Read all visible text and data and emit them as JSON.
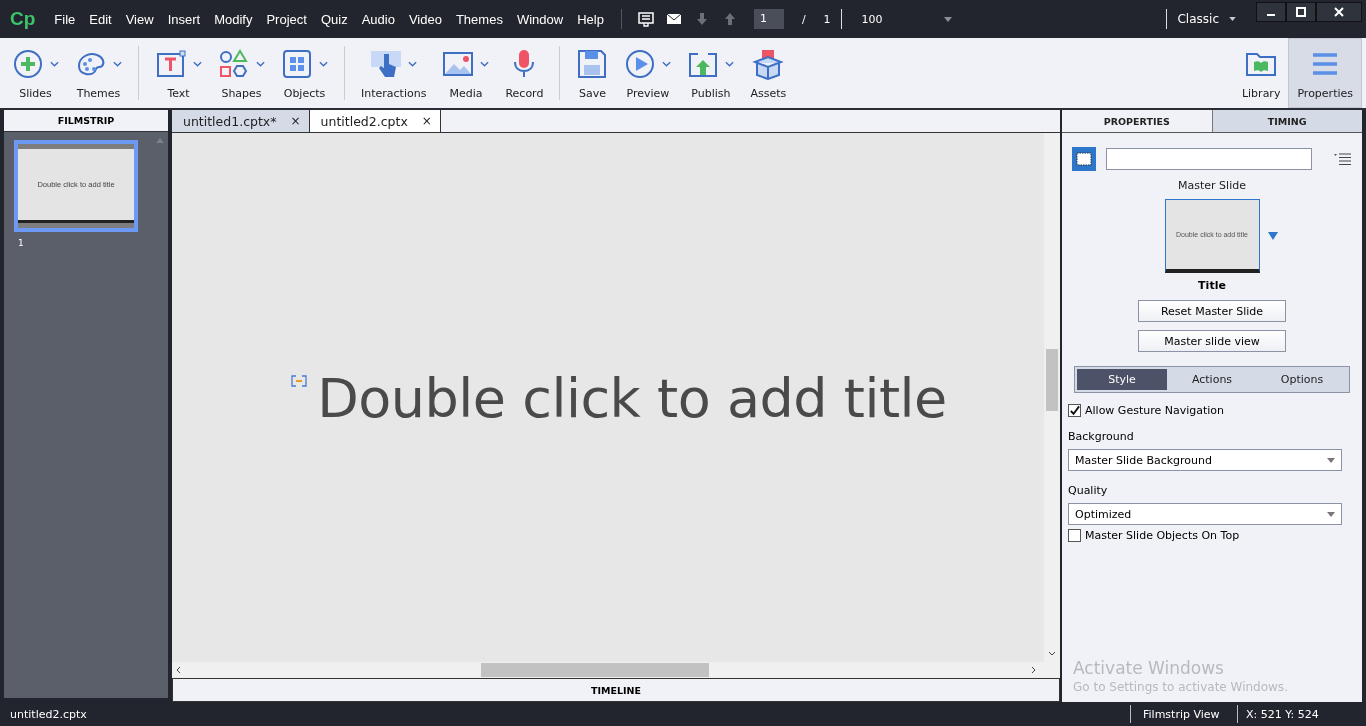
{
  "app": {
    "logo": "Cp"
  },
  "menu": [
    "File",
    "Edit",
    "View",
    "Insert",
    "Modify",
    "Project",
    "Quiz",
    "Audio",
    "Video",
    "Themes",
    "Window",
    "Help"
  ],
  "navigation": {
    "page": "1",
    "separator": "/",
    "total": "1",
    "zoom": "100"
  },
  "workspace": {
    "label": "Classic"
  },
  "toolbar": {
    "groups": [
      [
        {
          "label": "Slides",
          "has_menu": true
        },
        {
          "label": "Themes",
          "has_menu": true
        }
      ],
      [
        {
          "label": "Text",
          "has_menu": true
        },
        {
          "label": "Shapes",
          "has_menu": true
        },
        {
          "label": "Objects",
          "has_menu": true
        }
      ],
      [
        {
          "label": "Interactions",
          "has_menu": true
        },
        {
          "label": "Media",
          "has_menu": true
        },
        {
          "label": "Record",
          "has_menu": false
        }
      ],
      [
        {
          "label": "Save",
          "has_menu": false
        },
        {
          "label": "Preview",
          "has_menu": true
        },
        {
          "label": "Publish",
          "has_menu": true
        },
        {
          "label": "Assets",
          "has_menu": false
        }
      ]
    ],
    "right": [
      {
        "label": "Library",
        "selected": false
      },
      {
        "label": "Properties",
        "selected": true
      }
    ]
  },
  "filmstrip": {
    "title": "FILMSTRIP",
    "slides": [
      {
        "title": "Double click to add title",
        "number": "1",
        "selected": true
      }
    ]
  },
  "documents": [
    {
      "name": "untitled1.cptx*",
      "selected": false,
      "close": "×"
    },
    {
      "name": "untitled2.cptx",
      "selected": true,
      "close": "×"
    }
  ],
  "stage": {
    "title": "Double click to add title"
  },
  "timeline": {
    "title": "TIMELINE"
  },
  "properties": {
    "tabs": [
      {
        "label": "PROPERTIES",
        "selected": true
      },
      {
        "label": "TIMING",
        "selected": false
      }
    ],
    "master_label": "Master Slide",
    "master_thumb": "Double click to add title",
    "master_name": "Title",
    "buttons": [
      "Reset Master Slide",
      "Master slide view"
    ],
    "subtabs": [
      {
        "label": "Style",
        "selected": true
      },
      {
        "label": "Actions",
        "selected": false
      },
      {
        "label": "Options",
        "selected": false
      }
    ],
    "gesture": {
      "label": "Allow Gesture Navigation",
      "checked": true
    },
    "background": {
      "label": "Background",
      "value": "Master Slide Background"
    },
    "quality": {
      "label": "Quality",
      "value": "Optimized"
    },
    "objects_on_top": {
      "label": "Master Slide Objects On Top",
      "checked": false
    }
  },
  "activation": {
    "title": "Activate Windows",
    "text": "Go to Settings to activate Windows."
  },
  "status_bar": {
    "file": "untitled2.cptx",
    "view": "Filmstrip View",
    "coords": "X: 521 Y: 524"
  }
}
